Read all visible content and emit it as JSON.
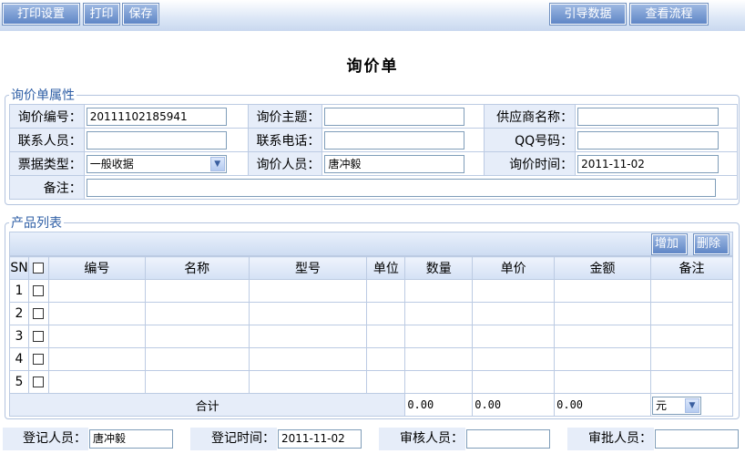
{
  "toolbar": {
    "print_settings": "打印设置",
    "print": "打印",
    "save": "保存",
    "guide_data": "引导数据",
    "view_flow": "查看流程"
  },
  "page_title": "询价单",
  "attributes": {
    "legend": "询价单属性",
    "inquiry_no_label": "询价编号：",
    "inquiry_no_value": "20111102185941",
    "subject_label": "询价主题：",
    "subject_value": "",
    "supplier_label": "供应商名称：",
    "supplier_value": "",
    "contact_label": "联系人员：",
    "contact_value": "",
    "phone_label": "联系电话：",
    "phone_value": "",
    "qq_label": "QQ号码：",
    "qq_value": "",
    "invoice_type_label": "票据类型：",
    "invoice_type_value": "一般收据",
    "inquirer_label": "询价人员：",
    "inquirer_value": "唐冲毅",
    "inquiry_time_label": "询价时间：",
    "inquiry_time_value": "2011-11-02",
    "remark_label": "备注：",
    "remark_value": ""
  },
  "products": {
    "legend": "产品列表",
    "add_button": "增加",
    "delete_button": "删除",
    "columns": [
      "SN",
      "编号",
      "名称",
      "型号",
      "单位",
      "数量",
      "单价",
      "金额",
      "备注"
    ],
    "rows": [
      {
        "sn": "1"
      },
      {
        "sn": "2"
      },
      {
        "sn": "3"
      },
      {
        "sn": "4"
      },
      {
        "sn": "5"
      }
    ],
    "total_label": "合计",
    "total_quantity": "0.00",
    "total_price": "0.00",
    "total_amount": "0.00",
    "currency": "元"
  },
  "footer": {
    "registrar_label": "登记人员：",
    "registrar_value": "唐冲毅",
    "register_time_label": "登记时间：",
    "register_time_value": "2011-11-02",
    "reviewer_label": "审核人员：",
    "reviewer_value": "",
    "approver_label": "审批人员：",
    "approver_value": ""
  },
  "colors": {
    "toolbar_button": "#6f8fbf",
    "legend_text": "#2f5fa6",
    "label_bg": "#e6edf9",
    "grid_border": "#bccbe3"
  }
}
